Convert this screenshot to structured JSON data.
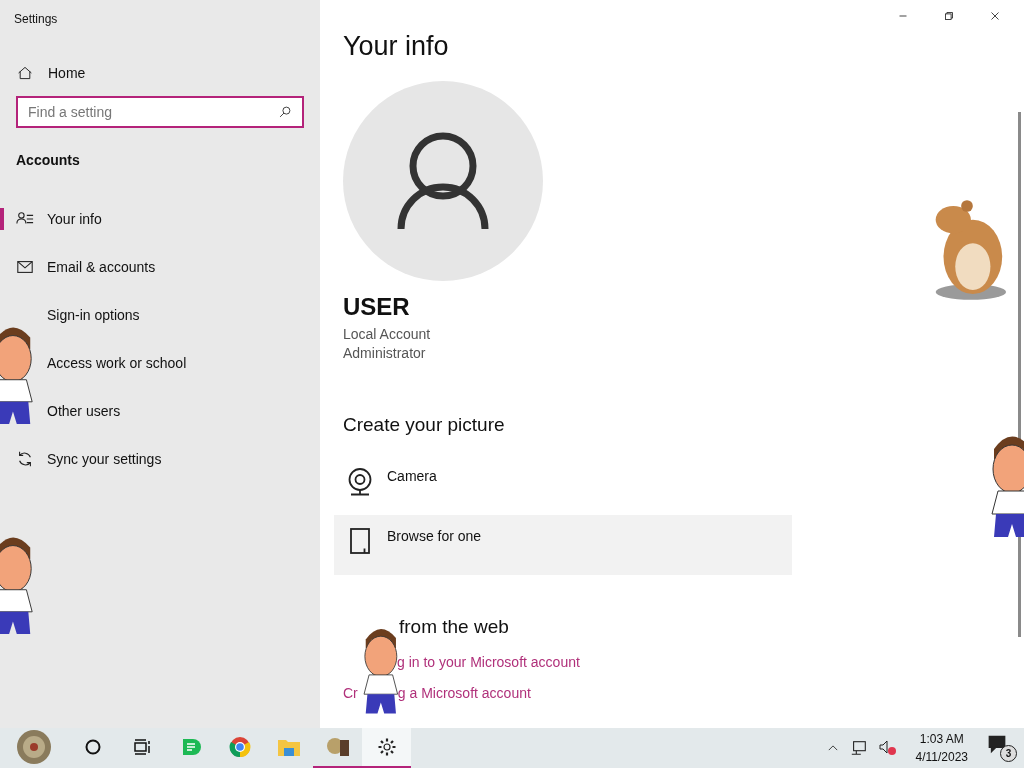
{
  "window": {
    "title": "Settings"
  },
  "sidebar": {
    "home": "Home",
    "search": {
      "placeholder": "Find a setting"
    },
    "section": "Accounts",
    "items": [
      {
        "label": "Your info",
        "selected": true
      },
      {
        "label": "Email & accounts",
        "selected": false
      },
      {
        "label": "Sign-in options",
        "selected": false
      },
      {
        "label": "Access work or school",
        "selected": false
      },
      {
        "label": "Other users",
        "selected": false
      },
      {
        "label": "Sync your settings",
        "selected": false
      }
    ]
  },
  "main": {
    "title": "Your info",
    "user": {
      "name": "USER",
      "lines": [
        "Local Account",
        "Administrator"
      ]
    },
    "picture_heading": "Create your picture",
    "options": [
      {
        "label": "Camera",
        "highlighted": false
      },
      {
        "label": "Browse for one",
        "highlighted": true
      }
    ],
    "web_heading": "from the web",
    "links": [
      {
        "parts": [
          "g in to your Microsoft account"
        ]
      },
      {
        "parts": [
          "Cr",
          "g a Microsoft account"
        ]
      }
    ]
  },
  "taskbar": {
    "apps": [
      {
        "running": false,
        "selected": false
      },
      {
        "running": false,
        "selected": false
      },
      {
        "running": false,
        "selected": false
      },
      {
        "running": false,
        "selected": false
      },
      {
        "running": false,
        "selected": false
      },
      {
        "running": true,
        "selected": false
      },
      {
        "running": true,
        "selected": true
      }
    ],
    "time": "1:03 AM",
    "date": "4/11/2023",
    "notifications": "3"
  }
}
